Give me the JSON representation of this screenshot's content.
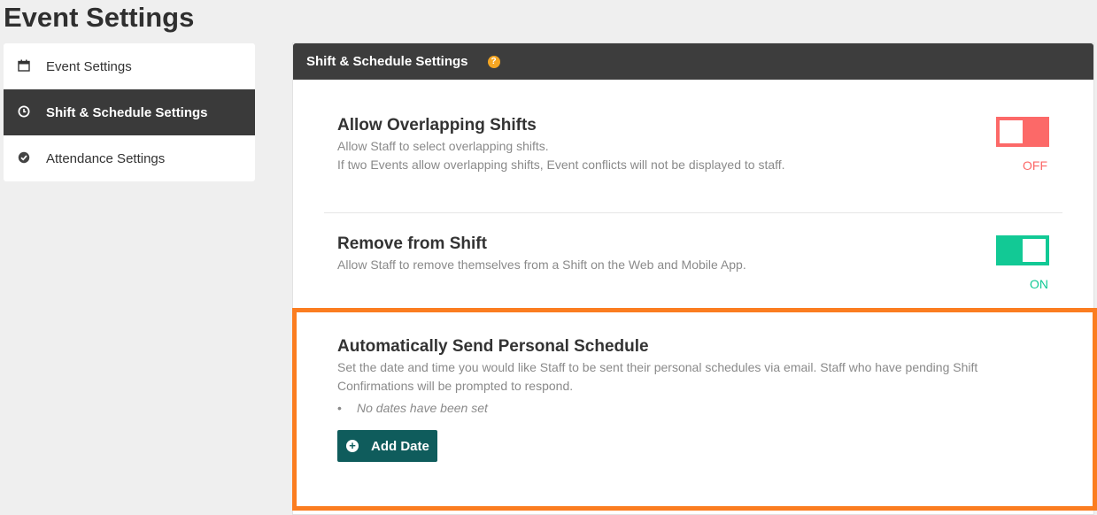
{
  "page": {
    "title": "Event Settings"
  },
  "sidebar": {
    "items": [
      {
        "label": "Event Settings",
        "icon": "calendar-icon",
        "active": false
      },
      {
        "label": "Shift & Schedule Settings",
        "icon": "clock-icon",
        "active": true
      },
      {
        "label": "Attendance Settings",
        "icon": "check-circle-icon",
        "active": false
      }
    ]
  },
  "panel": {
    "title": "Shift & Schedule Settings",
    "help_glyph": "?",
    "settings": {
      "overlap": {
        "title": "Allow Overlapping Shifts",
        "desc_1": "Allow Staff to select overlapping shifts.",
        "desc_2": "If two Events allow overlapping shifts, Event conflicts will not be displayed to staff.",
        "state": "OFF"
      },
      "remove": {
        "title": "Remove from Shift",
        "desc": "Allow Staff to remove themselves from a Shift on the Web and Mobile App.",
        "state": "ON"
      },
      "schedule": {
        "title": "Automatically Send Personal Schedule",
        "desc": "Set the date and time you would like Staff to be sent their personal schedules via email. Staff who have pending Shift Confirmations will be prompted to respond.",
        "empty_note": "No dates have been set",
        "add_button": "Add Date"
      }
    }
  },
  "colors": {
    "header_bg": "#3d3d3d",
    "toggle_off": "#fc6968",
    "toggle_on": "#12c995",
    "button_bg": "#0f5c5c",
    "highlight": "#fb7d20",
    "help": "#f5a623"
  }
}
